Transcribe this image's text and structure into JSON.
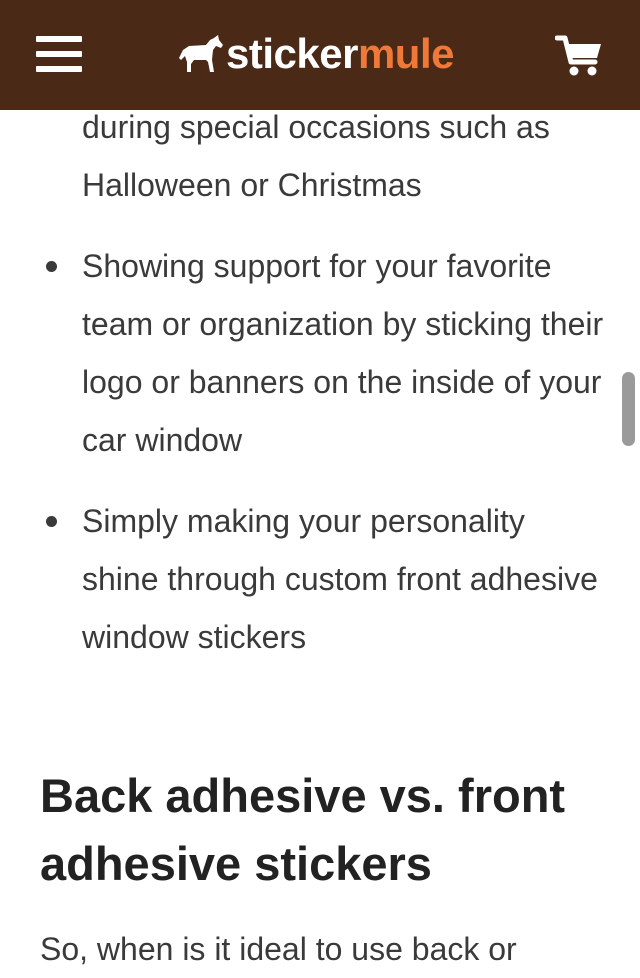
{
  "header": {
    "logo_word1": "sticker",
    "logo_word2": "mule",
    "colors": {
      "background": "#4a2a17",
      "logo_white": "#ffffff",
      "logo_orange": "#f0793a"
    },
    "icons": [
      "hamburger-menu-icon",
      "mule-logo-icon",
      "shopping-cart-icon"
    ]
  },
  "content": {
    "bullets": [
      {
        "text": "during special occasions such as Halloween or Christmas",
        "continued": true
      },
      {
        "text": "Showing support for your favorite team or organization by sticking their logo or banners on the inside of your car window",
        "continued": false
      },
      {
        "text": "Simply making your personality shine through custom front adhesive window stickers",
        "continued": false
      }
    ],
    "section_title": "Back adhesive vs. front adhesive stickers",
    "paragraph_start": "So, when is it ideal to use back or"
  }
}
